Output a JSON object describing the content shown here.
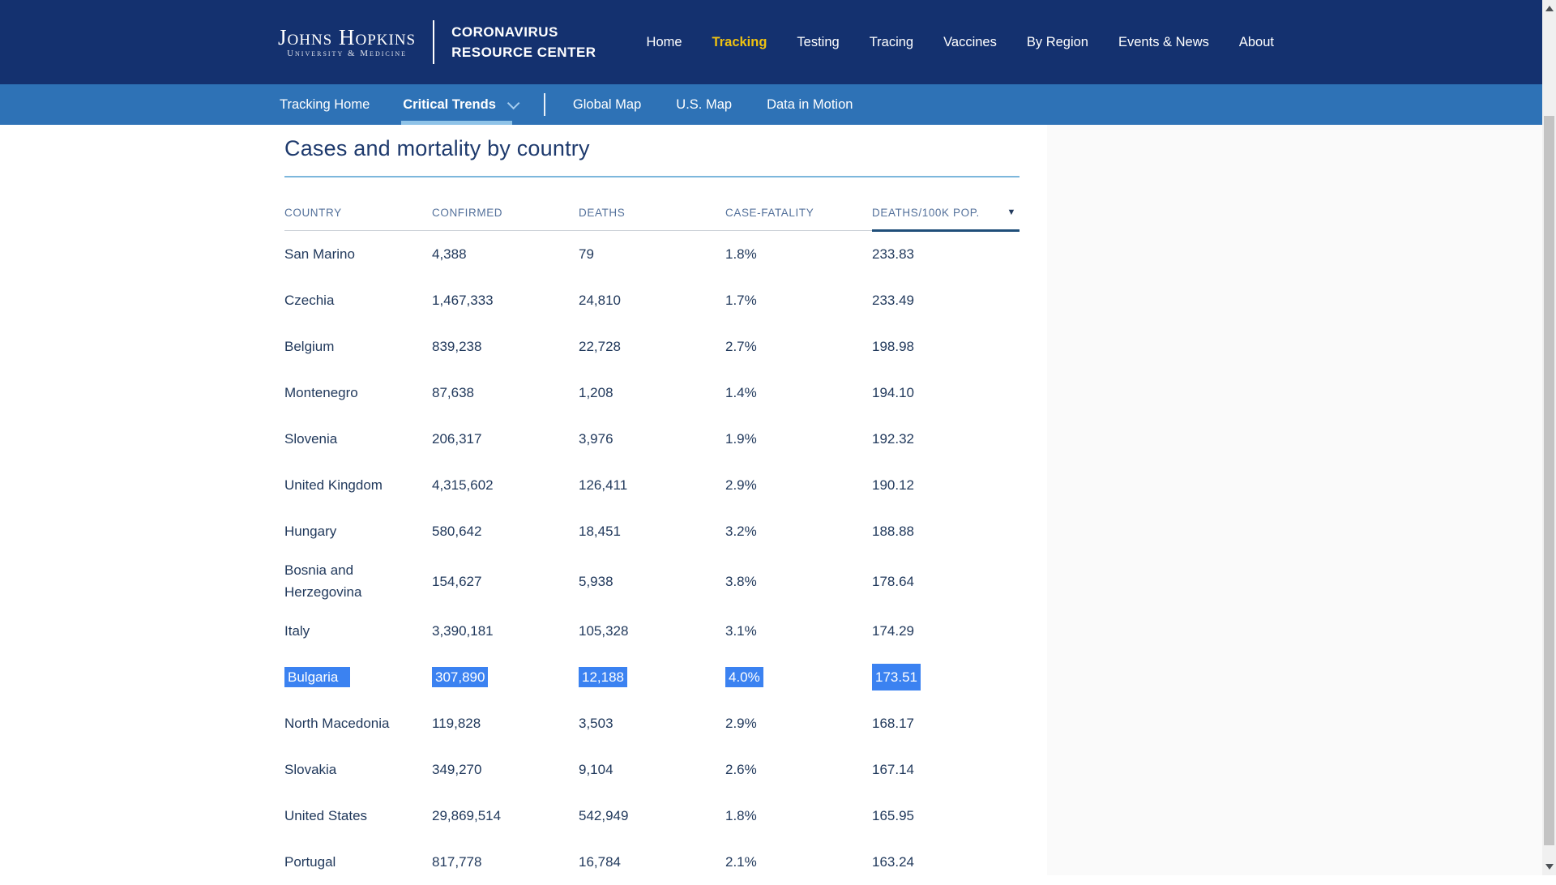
{
  "header": {
    "logo": {
      "line1": "Johns Hopkins",
      "line2": "University & Medicine"
    },
    "brand": {
      "line1": "CORONAVIRUS",
      "line2": "RESOURCE CENTER"
    },
    "nav": [
      {
        "label": "Home",
        "active": false
      },
      {
        "label": "Tracking",
        "active": true
      },
      {
        "label": "Testing",
        "active": false
      },
      {
        "label": "Tracing",
        "active": false
      },
      {
        "label": "Vaccines",
        "active": false
      },
      {
        "label": "By Region",
        "active": false
      },
      {
        "label": "Events & News",
        "active": false
      },
      {
        "label": "About",
        "active": false
      }
    ]
  },
  "subnav": {
    "items": [
      {
        "label": "Tracking Home",
        "active": false
      },
      {
        "label": "Critical Trends",
        "active": true,
        "has_chevron": true
      },
      {
        "label": "Global Map",
        "active": false
      },
      {
        "label": "U.S. Map",
        "active": false
      },
      {
        "label": "Data in Motion",
        "active": false
      }
    ]
  },
  "main": {
    "title": "Cases and mortality by country",
    "table": {
      "columns": [
        "COUNTRY",
        "CONFIRMED",
        "DEATHS",
        "CASE-FATALITY",
        "DEATHS/100K POP."
      ],
      "sort_column": "DEATHS/100K POP.",
      "sort_icon": "▼",
      "rows": [
        {
          "cells": [
            "San Marino",
            "4,388",
            "79",
            "1.8%",
            "233.83"
          ],
          "selected": false,
          "tall": false
        },
        {
          "cells": [
            "Czechia",
            "1,467,333",
            "24,810",
            "1.7%",
            "233.49"
          ],
          "selected": false,
          "tall": false
        },
        {
          "cells": [
            "Belgium",
            "839,238",
            "22,728",
            "2.7%",
            "198.98"
          ],
          "selected": false,
          "tall": false
        },
        {
          "cells": [
            "Montenegro",
            "87,638",
            "1,208",
            "1.4%",
            "194.10"
          ],
          "selected": false,
          "tall": false
        },
        {
          "cells": [
            "Slovenia",
            "206,317",
            "3,976",
            "1.9%",
            "192.32"
          ],
          "selected": false,
          "tall": false
        },
        {
          "cells": [
            "United Kingdom",
            "4,315,602",
            "126,411",
            "2.9%",
            "190.12"
          ],
          "selected": false,
          "tall": false
        },
        {
          "cells": [
            "Hungary",
            "580,642",
            "18,451",
            "3.2%",
            "188.88"
          ],
          "selected": false,
          "tall": false
        },
        {
          "cells": [
            "Bosnia and Herzegovina",
            "154,627",
            "5,938",
            "3.8%",
            "178.64"
          ],
          "selected": false,
          "tall": true
        },
        {
          "cells": [
            "Italy",
            "3,390,181",
            "105,328",
            "3.1%",
            "174.29"
          ],
          "selected": false,
          "tall": false
        },
        {
          "cells": [
            "Bulgaria",
            "307,890",
            "12,188",
            "4.0%",
            "173.51"
          ],
          "selected": true,
          "tall": false
        },
        {
          "cells": [
            "North Macedonia",
            "119,828",
            "3,503",
            "2.9%",
            "168.17"
          ],
          "selected": false,
          "tall": false
        },
        {
          "cells": [
            "Slovakia",
            "349,270",
            "9,104",
            "2.6%",
            "167.14"
          ],
          "selected": false,
          "tall": false
        },
        {
          "cells": [
            "United States",
            "29,869,514",
            "542,949",
            "1.8%",
            "165.95"
          ],
          "selected": false,
          "tall": false
        },
        {
          "cells": [
            "Portugal",
            "817,778",
            "16,784",
            "2.1%",
            "163.24"
          ],
          "selected": false,
          "tall": false
        }
      ]
    }
  },
  "colors": {
    "topnav_bg": "#14316f",
    "subnav_bg": "#2e72b6",
    "active_nav_gold": "#eec111",
    "active_tab_underline": "#8fc3e8",
    "title_text": "#1e3a6d",
    "table_text": "#21395c",
    "header_text": "#54719b",
    "title_rule": "#7db7dc",
    "sorted_underline": "#1f4e79",
    "selection_highlight": "#3b82f1",
    "right_panel_bg": "#fafafa"
  }
}
